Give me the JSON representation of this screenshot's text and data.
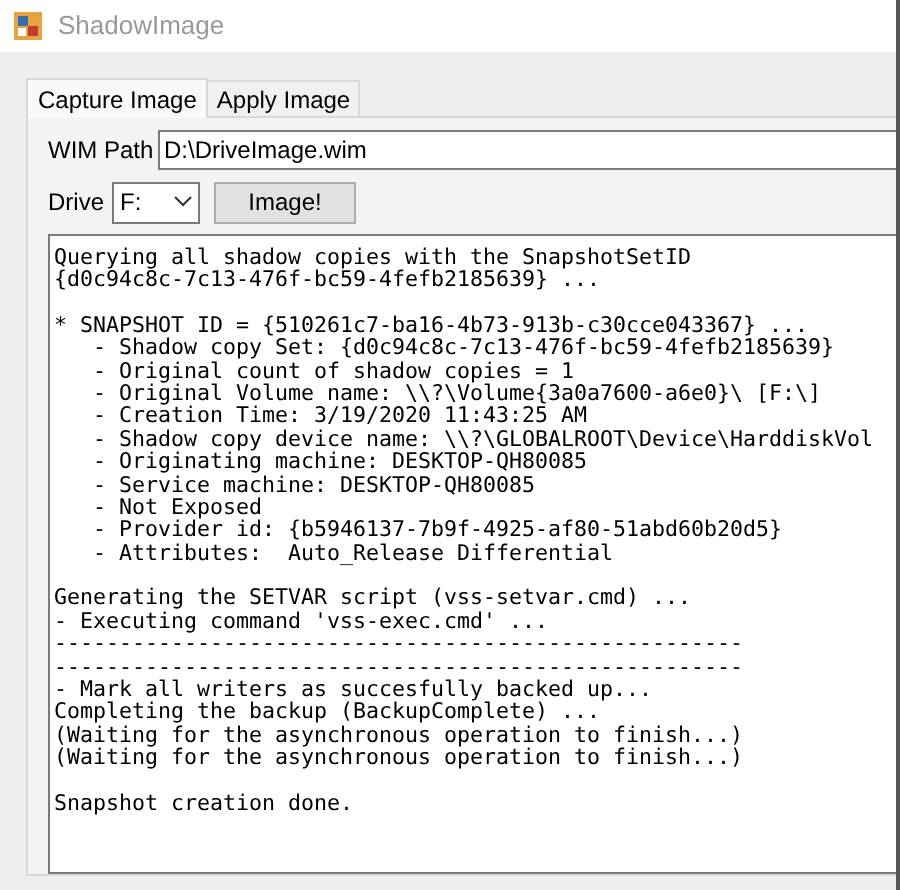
{
  "window": {
    "title": "ShadowImage"
  },
  "tabs": [
    {
      "label": "Capture Image",
      "selected": true
    },
    {
      "label": "Apply Image",
      "selected": false
    }
  ],
  "wim_path": {
    "label": "WIM Path",
    "value": "D:\\DriveImage.wim"
  },
  "drive": {
    "label": "Drive",
    "value": "F:"
  },
  "image_button": "Image!",
  "output": [
    [
      "Querying all shadow copies with the SnapshotSetID",
      "{d0c94c8c-7c13-476f-bc59-4fefb2185639} ..."
    ],
    [
      "* SNAPSHOT ID = {510261c7-ba16-4b73-913b-c30cce043367} ...",
      "   - Shadow copy Set: {d0c94c8c-7c13-476f-bc59-4fefb2185639}",
      "   - Original count of shadow copies = 1",
      "   - Original Volume name: \\\\?\\Volume{3a0a7600-a6e0}\\ [F:\\]",
      "   - Creation Time: 3/19/2020 11:43:25 AM",
      "   - Shadow copy device name: \\\\?\\GLOBALROOT\\Device\\HarddiskVol",
      "   - Originating machine: DESKTOP-QH80085",
      "   - Service machine: DESKTOP-QH80085",
      "   - Not Exposed",
      "   - Provider id: {b5946137-7b9f-4925-af80-51abd60b20d5}",
      "   - Attributes:  Auto_Release Differential"
    ],
    [
      "Generating the SETVAR script (vss-setvar.cmd) ...",
      "- Executing command 'vss-exec.cmd' ...",
      "-----------------------------------------------------",
      "-----------------------------------------------------",
      "- Mark all writers as succesfully backed up...",
      "Completing the backup (BackupComplete) ...",
      "(Waiting for the asynchronous operation to finish...)",
      "(Waiting for the asynchronous operation to finish...)"
    ],
    [
      "Snapshot creation done."
    ]
  ]
}
